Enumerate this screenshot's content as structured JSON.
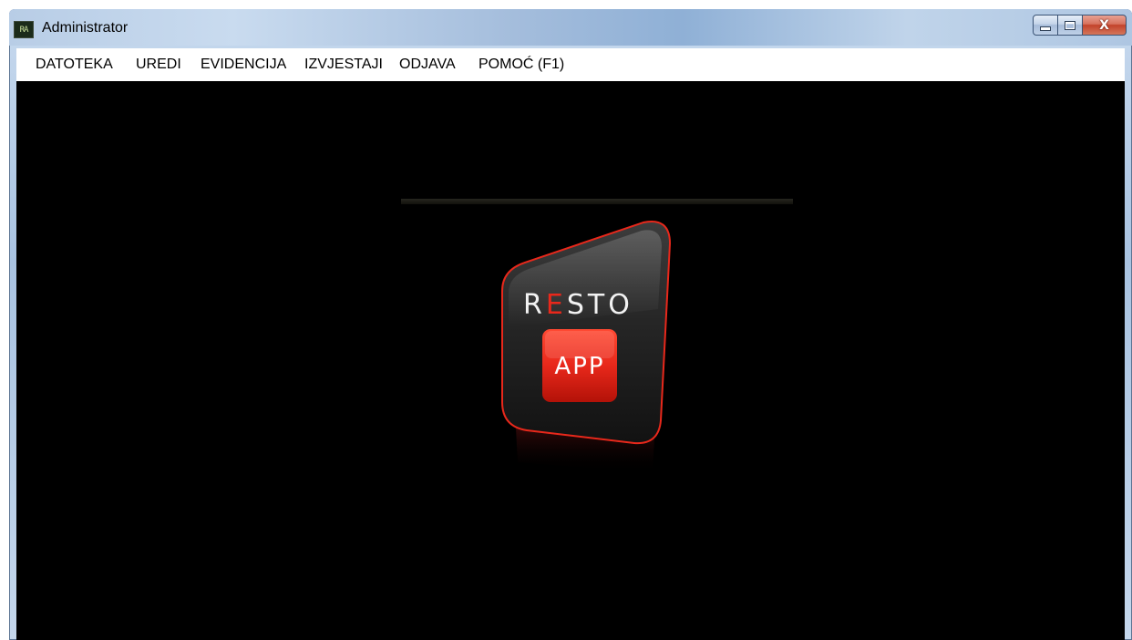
{
  "window": {
    "title": "Administrator",
    "icon": "app-icon",
    "icon_text": "RA"
  },
  "controls": {
    "minimize_icon": "minimize-icon",
    "maximize_icon": "maximize-icon",
    "close_icon": "close-icon",
    "close_glyph": "X"
  },
  "menu": {
    "items": [
      {
        "label": "DATOTEKA"
      },
      {
        "label": "UREDI"
      },
      {
        "label": "EVIDENCIJA"
      },
      {
        "label": "IZVJESTAJI"
      },
      {
        "label": "ODJAVA"
      },
      {
        "label": "POMOĆ (F1)"
      }
    ]
  },
  "logo": {
    "line1_first": "R",
    "line1_accent": "E",
    "line1_rest": "STO",
    "line2": "APP"
  },
  "colors": {
    "accent_red": "#e8281b",
    "titlebar": "#aec6e2",
    "client_bg": "#000000"
  }
}
